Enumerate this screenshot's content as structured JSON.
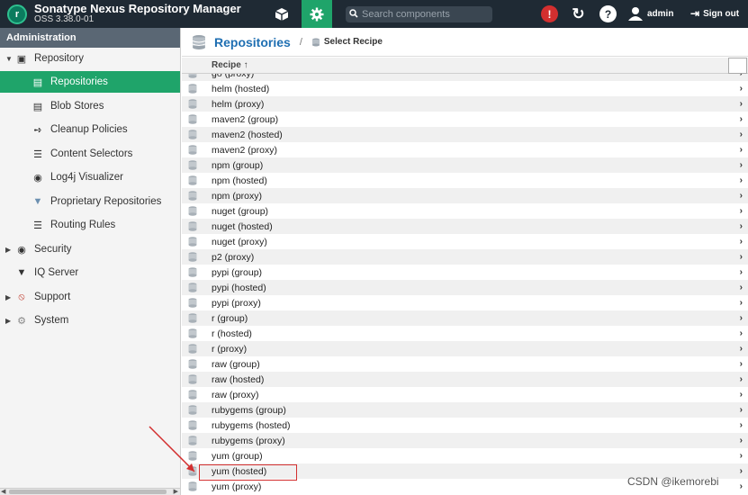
{
  "app": {
    "name": "Sonatype Nexus Repository Manager",
    "version": "OSS 3.38.0-01",
    "logo_letter": "r"
  },
  "header": {
    "search_placeholder": "Search components",
    "user": "admin",
    "signout_label": "Sign out",
    "colors": {
      "bar": "#1f2a34",
      "admin_active": "#1fa46a",
      "alert": "#d32f2f"
    }
  },
  "sidebar": {
    "heading": "Administration",
    "items": [
      {
        "label": "Repository",
        "icon": "database-icon",
        "expand": "down",
        "level": 0
      },
      {
        "label": "Repositories",
        "icon": "database-icon",
        "level": 1,
        "active": true
      },
      {
        "label": "Blob Stores",
        "icon": "server-icon",
        "level": 1
      },
      {
        "label": "Cleanup Policies",
        "icon": "broom-icon",
        "level": 1
      },
      {
        "label": "Content Selectors",
        "icon": "layers-icon",
        "level": 1
      },
      {
        "label": "Log4j Visualizer",
        "icon": "binoculars-icon",
        "level": 1
      },
      {
        "label": "Proprietary Repositories",
        "icon": "shield-database-icon",
        "level": 1
      },
      {
        "label": "Routing Rules",
        "icon": "signpost-icon",
        "level": 1
      },
      {
        "label": "Security",
        "icon": "eye-icon",
        "expand": "right",
        "level": 0
      },
      {
        "label": "IQ Server",
        "icon": "iq-shield-icon",
        "level": 0
      },
      {
        "label": "Support",
        "icon": "lifebuoy-icon",
        "expand": "right",
        "level": 0
      },
      {
        "label": "System",
        "icon": "gear-icon",
        "expand": "right",
        "level": 0
      }
    ]
  },
  "main": {
    "breadcrumb_title": "Repositories",
    "breadcrumb_sep": "/",
    "breadcrumb_current": "Select Recipe",
    "column_header": "Recipe ↑",
    "partial_top_row": "go (proxy)",
    "recipes": [
      "helm (hosted)",
      "helm (proxy)",
      "maven2 (group)",
      "maven2 (hosted)",
      "maven2 (proxy)",
      "npm (group)",
      "npm (hosted)",
      "npm (proxy)",
      "nuget (group)",
      "nuget (hosted)",
      "nuget (proxy)",
      "p2 (proxy)",
      "pypi (group)",
      "pypi (hosted)",
      "pypi (proxy)",
      "r (group)",
      "r (hosted)",
      "r (proxy)",
      "raw (group)",
      "raw (hosted)",
      "raw (proxy)",
      "rubygems (group)",
      "rubygems (hosted)",
      "rubygems (proxy)",
      "yum (group)",
      "yum (hosted)",
      "yum (proxy)"
    ],
    "highlighted_recipe": "yum (hosted)"
  },
  "watermark": "CSDN @ikemorebi"
}
